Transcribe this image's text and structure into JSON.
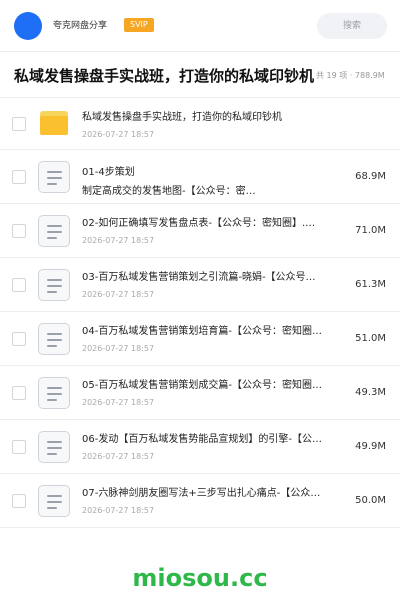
{
  "header": {
    "user_name": "夸克网盘分享",
    "badge": "SVIP",
    "search_placeholder": "搜索",
    "accent_color": "#1e6ff5",
    "badge_color": "#f5a623"
  },
  "title_bar": {
    "title": "私域发售操盘手实战班，打造你的私域印钞机",
    "summary": "共 19 项 · 788.9M"
  },
  "files": [
    {
      "name": "私域发售操盘手实战班，打造你的私域印钞机",
      "date": "2026-07-27 18:57",
      "size": "",
      "icon": "folder-icon"
    },
    {
      "name": "01-4步策划\n制定高成交的发售地图-【公众号：密…",
      "date": "",
      "size": "68.9M",
      "icon": "document-icon"
    },
    {
      "name": "02-如何正确填写发售盘点表-【公众号：密知圈】.…",
      "date": "2026-07-27 18:57",
      "size": "71.0M",
      "icon": "document-icon"
    },
    {
      "name": "03-百万私域发售营销策划之引流篇-晓娟-【公众号…",
      "date": "2026-07-27 18:57",
      "size": "61.3M",
      "icon": "document-icon"
    },
    {
      "name": "04-百万私域发售营销策划培育篇-【公众号：密知圈…",
      "date": "2026-07-27 18:57",
      "size": "51.0M",
      "icon": "document-icon"
    },
    {
      "name": "05-百万私域发售营销策划成交篇-【公众号：密知圈…",
      "date": "2026-07-27 18:57",
      "size": "49.3M",
      "icon": "document-icon"
    },
    {
      "name": "06-发动【百万私域发售势能品宣规划】的引擎-【公…",
      "date": "2026-07-27 18:57",
      "size": "49.9M",
      "icon": "document-icon"
    },
    {
      "name": "07-六脉神剑朋友圈写法+三步写出扎心痛点-【公众…",
      "date": "2026-07-27 18:57",
      "size": "50.0M",
      "icon": "document-icon"
    }
  ],
  "watermark": "miosou.cc"
}
